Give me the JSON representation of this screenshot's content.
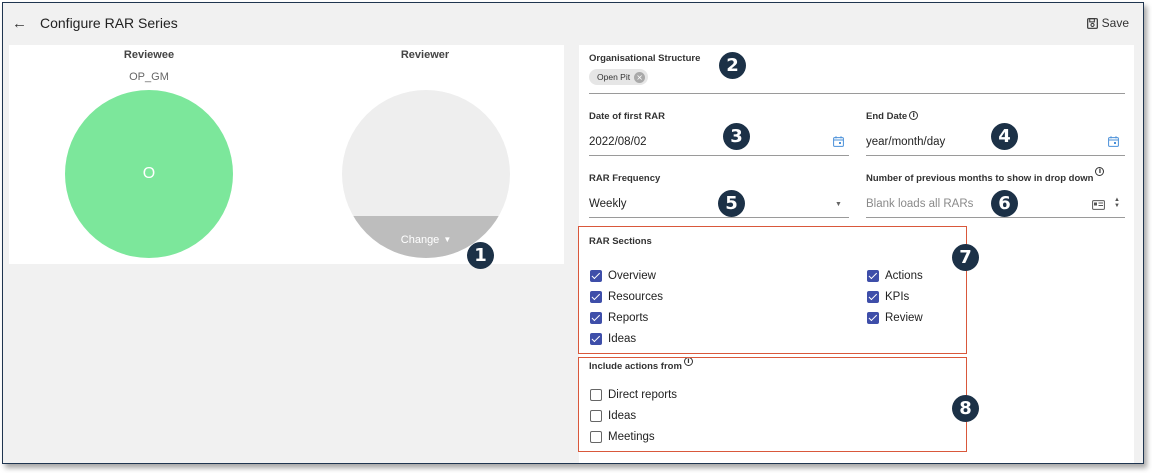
{
  "header": {
    "back_icon": "arrow-left-icon",
    "title": "Configure RAR Series",
    "save_label": "Save",
    "save_icon": "floppy-disk-icon"
  },
  "left": {
    "reviewee_label": "Reviewee",
    "reviewee_id": "OP_GM",
    "reviewee_initial": "O",
    "reviewee_color": "#7ce79b",
    "reviewer_label": "Reviewer",
    "reviewer_change_label": "Change",
    "reviewer_color": "#eeeeee"
  },
  "form": {
    "org_structure_label": "Organisational Structure",
    "org_chip": "Open Pit",
    "first_rar_label": "Date of first RAR",
    "first_rar_value": "2022/08/02",
    "end_date_label": "End Date",
    "end_date_placeholder": "year/month/day",
    "frequency_label": "RAR Frequency",
    "frequency_value": "Weekly",
    "months_label": "Number of previous months to show in drop down",
    "months_placeholder": "Blank loads all RARs",
    "info_glyph": "i"
  },
  "sections": {
    "title": "RAR Sections",
    "items": [
      {
        "label": "Overview",
        "checked": true
      },
      {
        "label": "Resources",
        "checked": true
      },
      {
        "label": "Reports",
        "checked": true
      },
      {
        "label": "Ideas",
        "checked": true
      },
      {
        "label": "Actions",
        "checked": true
      },
      {
        "label": "KPIs",
        "checked": true
      },
      {
        "label": "Review",
        "checked": true
      }
    ]
  },
  "actions_from": {
    "title": "Include actions from",
    "items": [
      {
        "label": "Direct reports",
        "checked": false
      },
      {
        "label": "Ideas",
        "checked": false
      },
      {
        "label": "Meetings",
        "checked": false
      }
    ]
  },
  "callouts": [
    "1",
    "2",
    "3",
    "4",
    "5",
    "6",
    "7",
    "8"
  ],
  "colors": {
    "accent_checkbox": "#3e4ea9",
    "callout_bg": "#1c3147",
    "highlight_border": "#d9583b",
    "date_icon": "#4a90d9"
  }
}
